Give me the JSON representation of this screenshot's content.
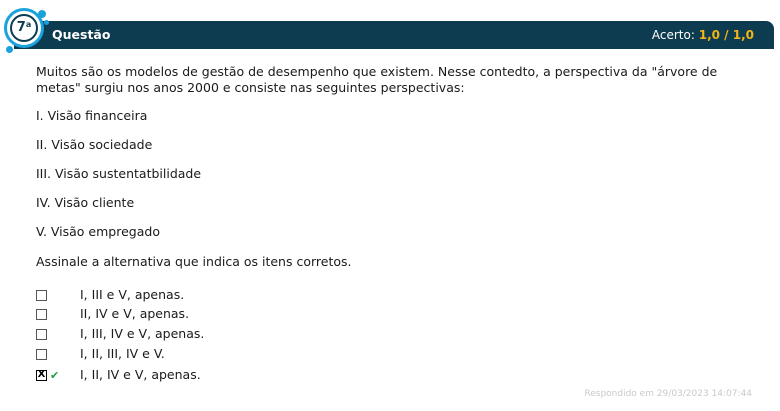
{
  "header": {
    "badge_number": "7",
    "badge_suffix": "a",
    "title": "Questão",
    "score_label": "Acerto:",
    "score_value": "1,0 / 1,0"
  },
  "question": {
    "text": "Muitos são os modelos de gestão de desempenho que existem. Nesse contedto, a perspectiva da \"árvore de metas\" surgiu nos anos 2000 e consiste nas seguintes perspectivas:",
    "items": [
      "I. Visão financeira",
      "II. Visão sociedade",
      "III. Visão sustentatbilidade",
      "IV. Visão cliente",
      "V. Visão empregado"
    ],
    "instruction": "Assinale a alternativa que indica os itens corretos."
  },
  "options": [
    {
      "label": "I, III e V, apenas.",
      "checked": false,
      "correct": false
    },
    {
      "label": "II, IV e V, apenas.",
      "checked": false,
      "correct": false
    },
    {
      "label": "I, III, IV e V, apenas.",
      "checked": false,
      "correct": false
    },
    {
      "label": "I, II, III, IV e V.",
      "checked": false,
      "correct": false
    },
    {
      "label": "I, II, IV e V, apenas.",
      "checked": true,
      "correct": true
    }
  ],
  "checkbox_mark": "X",
  "correct_mark": "✔",
  "footer": "Respondido em 29/03/2023 14:07:44",
  "colors": {
    "header_bg": "#0d3b4f",
    "badge_ring": "#1aa2dc",
    "score_value": "#f2b418",
    "correct": "#1e9d3a"
  }
}
